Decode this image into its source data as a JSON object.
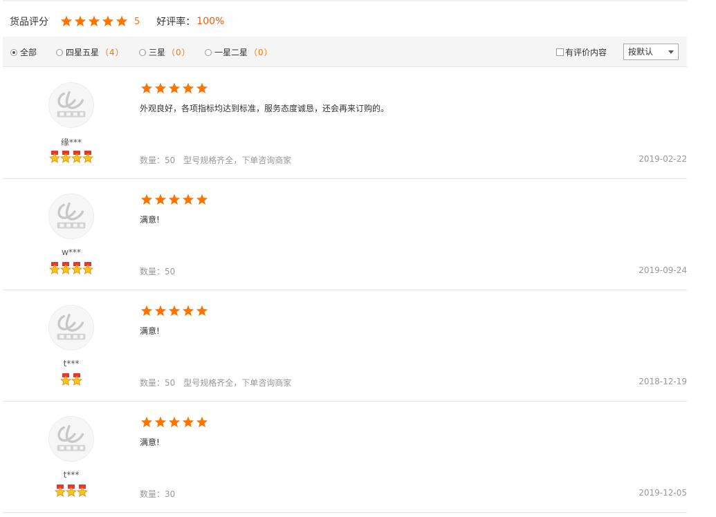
{
  "summary": {
    "label": "货品评分",
    "score": "5",
    "rate_label": "好评率：",
    "rate_value": "100%"
  },
  "filter": {
    "options": [
      {
        "label": "全部",
        "count": "",
        "selected": true
      },
      {
        "label": "四星五星",
        "count": "（4）",
        "selected": false
      },
      {
        "label": "三星",
        "count": "（0）",
        "selected": false
      },
      {
        "label": "一星二星",
        "count": "（0）",
        "selected": false
      }
    ],
    "has_content_label": "有评价内容",
    "sort_value": "按默认"
  },
  "colors": {
    "star": "#ff7300",
    "accent": "#ff5500",
    "muted": "#999999"
  },
  "reviews": [
    {
      "user": "缘***",
      "badge_count": 4,
      "stars": 5,
      "content": "外观良好，各项指标均达到标准，服务态度诚恳，还会再来订购的。",
      "quantity": "数量：50",
      "spec": "型号规格齐全，下单咨询商家",
      "date": "2019-02-22"
    },
    {
      "user": "w***",
      "badge_count": 4,
      "stars": 5,
      "content": "满意!",
      "quantity": "数量：50",
      "spec": "",
      "date": "2019-09-24"
    },
    {
      "user": "t***",
      "badge_count": 2,
      "stars": 5,
      "content": "满意!",
      "quantity": "数量：50",
      "spec": "型号规格齐全，下单咨询商家",
      "date": "2018-12-19"
    },
    {
      "user": "t***",
      "badge_count": 3,
      "stars": 5,
      "content": "满意!",
      "quantity": "数量：30",
      "spec": "",
      "date": "2019-12-05"
    }
  ]
}
